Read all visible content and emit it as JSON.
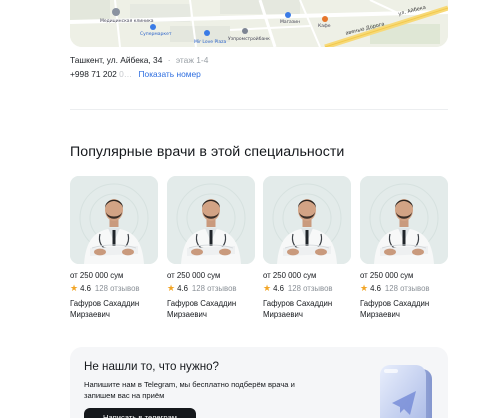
{
  "map": {
    "labels": {
      "hospital": "Медицинская клиника",
      "supermarket": "Супермаркет",
      "plaza": "Mir Love Plaza",
      "bank": "Узпромстройбанк",
      "street": "ул. Айбека",
      "avenue": "авенью Дорога",
      "store": "Магазин",
      "bakery": "Кафе"
    }
  },
  "location": {
    "address": "Ташкент, ул. Айбека, 34",
    "separator": " · ",
    "floor": "этаж 1-4",
    "phone_visible": "+998 71 202",
    "phone_hidden": " 0…",
    "show_number": "Показать номер"
  },
  "popular": {
    "title": "Популярные врачи в этой специальности",
    "doctors": [
      {
        "price": "от 250 000 сум",
        "rating": "4.6",
        "reviews": "128 отзывов",
        "name": "Гафуров Сахаддин Мирзаевич"
      },
      {
        "price": "от 250 000 сум",
        "rating": "4.6",
        "reviews": "128 отзывов",
        "name": "Гафуров Сахаддин Мирзаевич"
      },
      {
        "price": "от 250 000 сум",
        "rating": "4.6",
        "reviews": "128 отзывов",
        "name": "Гафуров Сахаддин Мирзаевич"
      },
      {
        "price": "от 250 000 сум",
        "rating": "4.6",
        "reviews": "128 отзывов",
        "name": "Гафуров Сахаддин Мирзаевич"
      }
    ]
  },
  "banner": {
    "title": "Не нашли то, что нужно?",
    "text": "Напишите нам в Telegram, мы бесплатно подберём врача и запишем вас на приём",
    "button": "Написать в телеграм"
  },
  "icons": {
    "star": "star-icon",
    "telegram": "telegram-3d-icon"
  },
  "colors": {
    "accent": "#2f6fe0",
    "star": "#f2a526",
    "button_bg": "#15181c"
  }
}
